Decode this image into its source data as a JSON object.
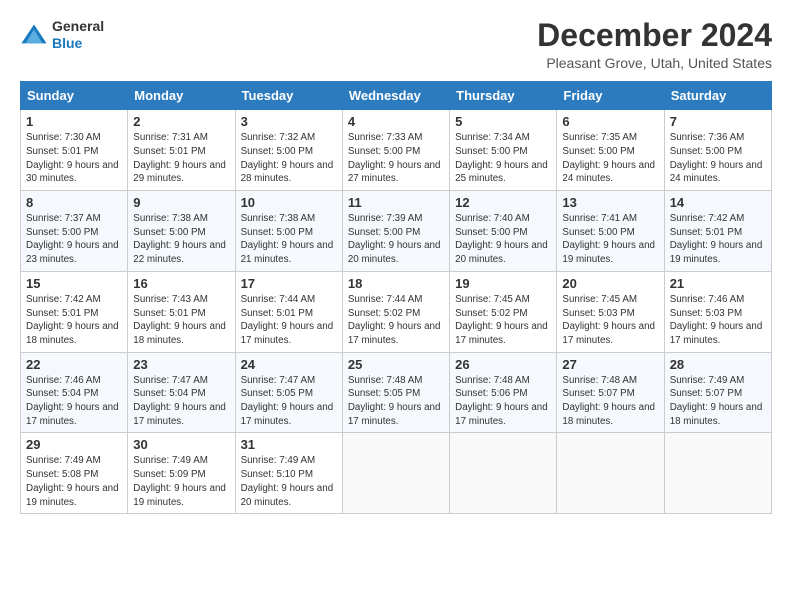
{
  "header": {
    "logo_general": "General",
    "logo_blue": "Blue",
    "title": "December 2024",
    "location": "Pleasant Grove, Utah, United States"
  },
  "weekdays": [
    "Sunday",
    "Monday",
    "Tuesday",
    "Wednesday",
    "Thursday",
    "Friday",
    "Saturday"
  ],
  "weeks": [
    [
      {
        "day": "1",
        "sunrise": "7:30 AM",
        "sunset": "5:01 PM",
        "daylight": "9 hours and 30 minutes."
      },
      {
        "day": "2",
        "sunrise": "7:31 AM",
        "sunset": "5:01 PM",
        "daylight": "9 hours and 29 minutes."
      },
      {
        "day": "3",
        "sunrise": "7:32 AM",
        "sunset": "5:00 PM",
        "daylight": "9 hours and 28 minutes."
      },
      {
        "day": "4",
        "sunrise": "7:33 AM",
        "sunset": "5:00 PM",
        "daylight": "9 hours and 27 minutes."
      },
      {
        "day": "5",
        "sunrise": "7:34 AM",
        "sunset": "5:00 PM",
        "daylight": "9 hours and 25 minutes."
      },
      {
        "day": "6",
        "sunrise": "7:35 AM",
        "sunset": "5:00 PM",
        "daylight": "9 hours and 24 minutes."
      },
      {
        "day": "7",
        "sunrise": "7:36 AM",
        "sunset": "5:00 PM",
        "daylight": "9 hours and 24 minutes."
      }
    ],
    [
      {
        "day": "8",
        "sunrise": "7:37 AM",
        "sunset": "5:00 PM",
        "daylight": "9 hours and 23 minutes."
      },
      {
        "day": "9",
        "sunrise": "7:38 AM",
        "sunset": "5:00 PM",
        "daylight": "9 hours and 22 minutes."
      },
      {
        "day": "10",
        "sunrise": "7:38 AM",
        "sunset": "5:00 PM",
        "daylight": "9 hours and 21 minutes."
      },
      {
        "day": "11",
        "sunrise": "7:39 AM",
        "sunset": "5:00 PM",
        "daylight": "9 hours and 20 minutes."
      },
      {
        "day": "12",
        "sunrise": "7:40 AM",
        "sunset": "5:00 PM",
        "daylight": "9 hours and 20 minutes."
      },
      {
        "day": "13",
        "sunrise": "7:41 AM",
        "sunset": "5:00 PM",
        "daylight": "9 hours and 19 minutes."
      },
      {
        "day": "14",
        "sunrise": "7:42 AM",
        "sunset": "5:01 PM",
        "daylight": "9 hours and 19 minutes."
      }
    ],
    [
      {
        "day": "15",
        "sunrise": "7:42 AM",
        "sunset": "5:01 PM",
        "daylight": "9 hours and 18 minutes."
      },
      {
        "day": "16",
        "sunrise": "7:43 AM",
        "sunset": "5:01 PM",
        "daylight": "9 hours and 18 minutes."
      },
      {
        "day": "17",
        "sunrise": "7:44 AM",
        "sunset": "5:01 PM",
        "daylight": "9 hours and 17 minutes."
      },
      {
        "day": "18",
        "sunrise": "7:44 AM",
        "sunset": "5:02 PM",
        "daylight": "9 hours and 17 minutes."
      },
      {
        "day": "19",
        "sunrise": "7:45 AM",
        "sunset": "5:02 PM",
        "daylight": "9 hours and 17 minutes."
      },
      {
        "day": "20",
        "sunrise": "7:45 AM",
        "sunset": "5:03 PM",
        "daylight": "9 hours and 17 minutes."
      },
      {
        "day": "21",
        "sunrise": "7:46 AM",
        "sunset": "5:03 PM",
        "daylight": "9 hours and 17 minutes."
      }
    ],
    [
      {
        "day": "22",
        "sunrise": "7:46 AM",
        "sunset": "5:04 PM",
        "daylight": "9 hours and 17 minutes."
      },
      {
        "day": "23",
        "sunrise": "7:47 AM",
        "sunset": "5:04 PM",
        "daylight": "9 hours and 17 minutes."
      },
      {
        "day": "24",
        "sunrise": "7:47 AM",
        "sunset": "5:05 PM",
        "daylight": "9 hours and 17 minutes."
      },
      {
        "day": "25",
        "sunrise": "7:48 AM",
        "sunset": "5:05 PM",
        "daylight": "9 hours and 17 minutes."
      },
      {
        "day": "26",
        "sunrise": "7:48 AM",
        "sunset": "5:06 PM",
        "daylight": "9 hours and 17 minutes."
      },
      {
        "day": "27",
        "sunrise": "7:48 AM",
        "sunset": "5:07 PM",
        "daylight": "9 hours and 18 minutes."
      },
      {
        "day": "28",
        "sunrise": "7:49 AM",
        "sunset": "5:07 PM",
        "daylight": "9 hours and 18 minutes."
      }
    ],
    [
      {
        "day": "29",
        "sunrise": "7:49 AM",
        "sunset": "5:08 PM",
        "daylight": "9 hours and 19 minutes."
      },
      {
        "day": "30",
        "sunrise": "7:49 AM",
        "sunset": "5:09 PM",
        "daylight": "9 hours and 19 minutes."
      },
      {
        "day": "31",
        "sunrise": "7:49 AM",
        "sunset": "5:10 PM",
        "daylight": "9 hours and 20 minutes."
      },
      null,
      null,
      null,
      null
    ]
  ]
}
